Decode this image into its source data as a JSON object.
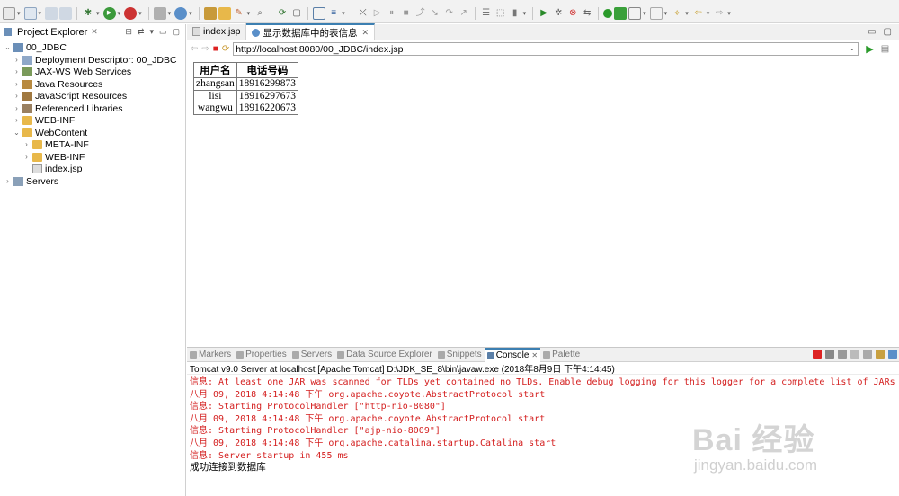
{
  "explorer": {
    "title": "Project Explorer",
    "tree": [
      {
        "label": "00_JDBC",
        "icon": "project-icon",
        "expanded": true
      },
      {
        "label": "Deployment Descriptor: 00_JDBC",
        "icon": "deployment-icon"
      },
      {
        "label": "JAX-WS Web Services",
        "icon": "webservice-icon"
      },
      {
        "label": "Java Resources",
        "icon": "java-resources-icon"
      },
      {
        "label": "JavaScript Resources",
        "icon": "js-resources-icon"
      },
      {
        "label": "Referenced Libraries",
        "icon": "library-icon"
      },
      {
        "label": "WEB-INF",
        "icon": "folder-icon"
      },
      {
        "label": "WebContent",
        "icon": "folder-icon",
        "expanded": true
      },
      {
        "label": "META-INF",
        "icon": "folder-icon"
      },
      {
        "label": "WEB-INF",
        "icon": "folder-icon"
      },
      {
        "label": "index.jsp",
        "icon": "jsp-file-icon"
      },
      {
        "label": "Servers",
        "icon": "servers-icon"
      }
    ]
  },
  "editor": {
    "tabs": [
      {
        "label": "index.jsp",
        "active": false
      },
      {
        "label": "显示数据库中的表信息",
        "active": true
      }
    ],
    "url": "http://localhost:8080/00_JDBC/index.jsp"
  },
  "table": {
    "headers": [
      "用户名",
      "电话号码"
    ],
    "rows": [
      [
        "zhangsan",
        "18916299873"
      ],
      [
        "lisi",
        "18916297673"
      ],
      [
        "wangwu",
        "18916220673"
      ]
    ]
  },
  "console": {
    "tabs": [
      "Markers",
      "Properties",
      "Servers",
      "Data Source Explorer",
      "Snippets",
      "Console",
      "Palette"
    ],
    "active_tab": "Console",
    "header": "Tomcat v9.0 Server at localhost [Apache Tomcat] D:\\JDK_SE_8\\bin\\javaw.exe (2018年8月9日 下午4:14:45)",
    "lines": [
      {
        "text": "信息: At least one JAR was scanned for TLDs yet contained no TLDs. Enable debug logging for this logger for a complete list of JARs th",
        "color": "red"
      },
      {
        "text": "八月 09, 2018 4:14:48 下午 org.apache.coyote.AbstractProtocol start",
        "color": "red"
      },
      {
        "text": "信息: Starting ProtocolHandler [\"http-nio-8080\"]",
        "color": "red"
      },
      {
        "text": "八月 09, 2018 4:14:48 下午 org.apache.coyote.AbstractProtocol start",
        "color": "red"
      },
      {
        "text": "信息: Starting ProtocolHandler [\"ajp-nio-8009\"]",
        "color": "red"
      },
      {
        "text": "八月 09, 2018 4:14:48 下午 org.apache.catalina.startup.Catalina start",
        "color": "red"
      },
      {
        "text": "信息: Server startup in 455 ms",
        "color": "red"
      },
      {
        "text": "成功连接到数据库",
        "color": "black"
      }
    ]
  },
  "watermark": {
    "brand": "Bai 经验",
    "url": "jingyan.baidu.com"
  },
  "colors": {
    "console_red": "#d42020",
    "tab_accent": "#3c7fb1",
    "folder": "#e8b84a"
  }
}
